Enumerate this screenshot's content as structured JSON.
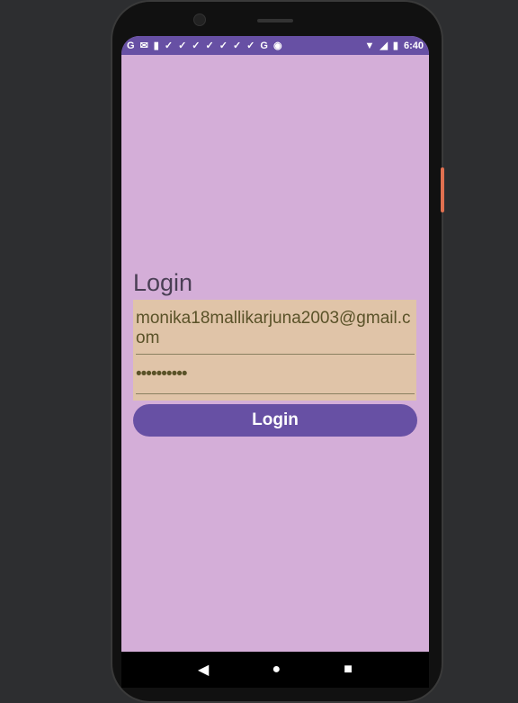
{
  "status_bar": {
    "time": "6:40",
    "icons": [
      "google-icon",
      "gmail-icon",
      "sim-card-icon",
      "check-icon",
      "check-icon",
      "check-icon",
      "check-icon",
      "check-icon",
      "check-icon",
      "check-icon",
      "google-icon",
      "record-icon"
    ]
  },
  "login": {
    "title": "Login",
    "email_value": "monika18mallikarjuna2003@gmail.com",
    "password_value": "••••••••••",
    "button_label": "Login"
  },
  "colors": {
    "primary": "#6750a4",
    "background": "#d4aed8",
    "form": "#e0c4a8"
  }
}
